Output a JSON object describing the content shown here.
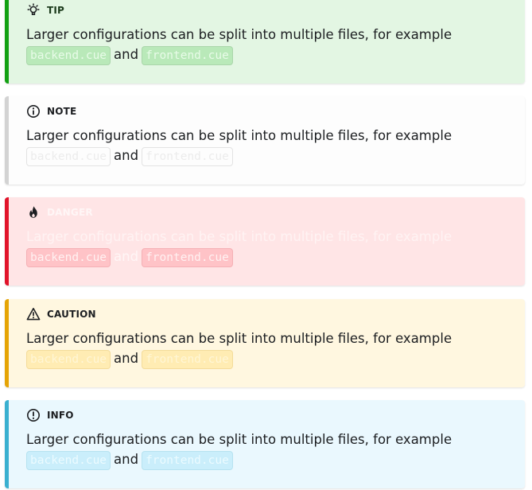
{
  "admonitions": [
    {
      "kind": "tip",
      "icon": "lightbulb-icon",
      "title": "TIP",
      "text": "Larger configurations can be split into multiple files, for example",
      "file1": "backend.cue",
      "connector": "and",
      "file2": "frontend.cue",
      "accent": "#14a114",
      "background": "#e3f6e3"
    },
    {
      "kind": "note",
      "icon": "info-circle-icon",
      "title": "NOTE",
      "text": "Larger configurations can be split into multiple files, for example",
      "file1": "backend.cue",
      "connector": "and",
      "file2": "frontend.cue",
      "accent": "#d3d3d3",
      "background": "#fdfdfd"
    },
    {
      "kind": "danger",
      "icon": "flame-icon",
      "title": "DANGER",
      "text": "Larger configurations can be split into multiple files, for example",
      "file1": "backend.cue",
      "connector": "and",
      "file2": "frontend.cue",
      "accent": "#e1132a",
      "background": "#ffe5e6"
    },
    {
      "kind": "caution",
      "icon": "warning-triangle-icon",
      "title": "CAUTION",
      "text": "Larger configurations can be split into multiple files, for example",
      "file1": "backend.cue",
      "connector": "and",
      "file2": "frontend.cue",
      "accent": "#e5a405",
      "background": "#fff7e0"
    },
    {
      "kind": "info",
      "icon": "info-circle-icon",
      "title": "INFO",
      "text": "Larger configurations can be split into multiple files, for example",
      "file1": "backend.cue",
      "connector": "and",
      "file2": "frontend.cue",
      "accent": "#3ab0d0",
      "background": "#eaf8fe"
    }
  ]
}
